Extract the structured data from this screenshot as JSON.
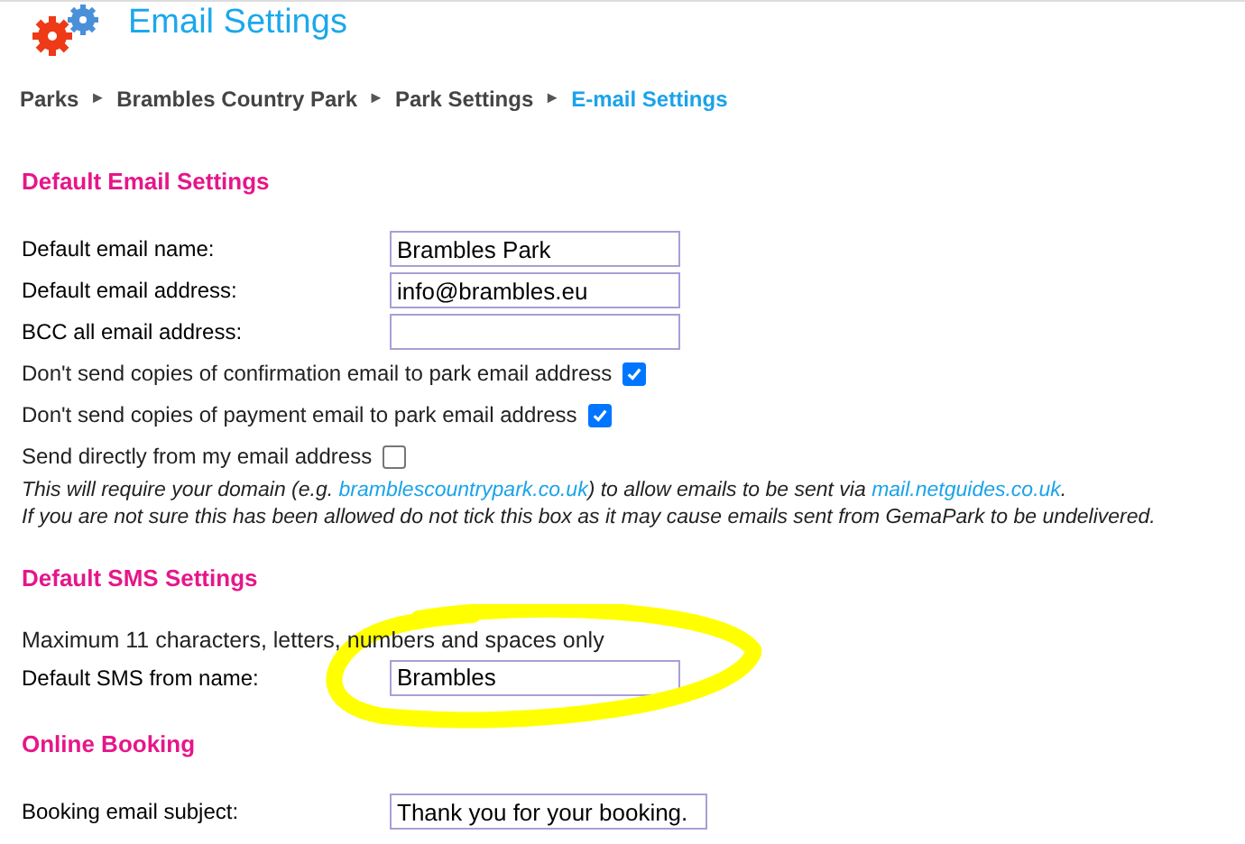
{
  "title": "Email Settings",
  "breadcrumb": [
    {
      "label": "Parks",
      "selected": false
    },
    {
      "label": "Brambles Country Park",
      "selected": false
    },
    {
      "label": "Park Settings",
      "selected": false
    },
    {
      "label": "E-mail Settings",
      "selected": true
    }
  ],
  "breadcrumb_separator": "►",
  "sections": [
    {
      "heading": "Default Email Settings",
      "rows": [
        {
          "kind": "field",
          "label": "Default email name:",
          "value": "Brambles Park"
        },
        {
          "kind": "field",
          "label": "Default email address:",
          "value": "info@brambles.eu"
        },
        {
          "kind": "field",
          "label": "BCC all email address:",
          "value": ""
        },
        {
          "kind": "checkbox",
          "label": "Don't send copies of confirmation email to park email address",
          "checked": true
        },
        {
          "kind": "checkbox",
          "label": "Don't send copies of payment email to park email address",
          "checked": true
        },
        {
          "kind": "checkbox",
          "label": "Send directly from my email address",
          "checked": false
        },
        {
          "kind": "note",
          "parts": [
            {
              "text": "This will require your domain (e.g. ",
              "link": false
            },
            {
              "text": "bramblescountrypark.co.uk",
              "link": true
            },
            {
              "text": ") to allow emails to be sent via ",
              "link": false
            },
            {
              "text": "mail.netguides.co.uk",
              "link": true
            },
            {
              "text": ".",
              "link": false
            }
          ]
        },
        {
          "kind": "note",
          "parts": [
            {
              "text": "If you are not sure this has been allowed do not tick this box as it may cause emails sent from GemaPark to be undelivered.",
              "link": false
            }
          ]
        }
      ]
    },
    {
      "heading": "Default SMS Settings",
      "highlighted": true,
      "rows": [
        {
          "kind": "text",
          "text": "Maximum 11 characters, letters, numbers and spaces only"
        },
        {
          "kind": "field",
          "label": "Default SMS from name:",
          "value": "Brambles"
        }
      ]
    },
    {
      "heading": "Online Booking",
      "rows": [
        {
          "kind": "field",
          "label": "Booking email subject:",
          "value": "Thank you for your booking.",
          "wide": true
        }
      ]
    }
  ]
}
